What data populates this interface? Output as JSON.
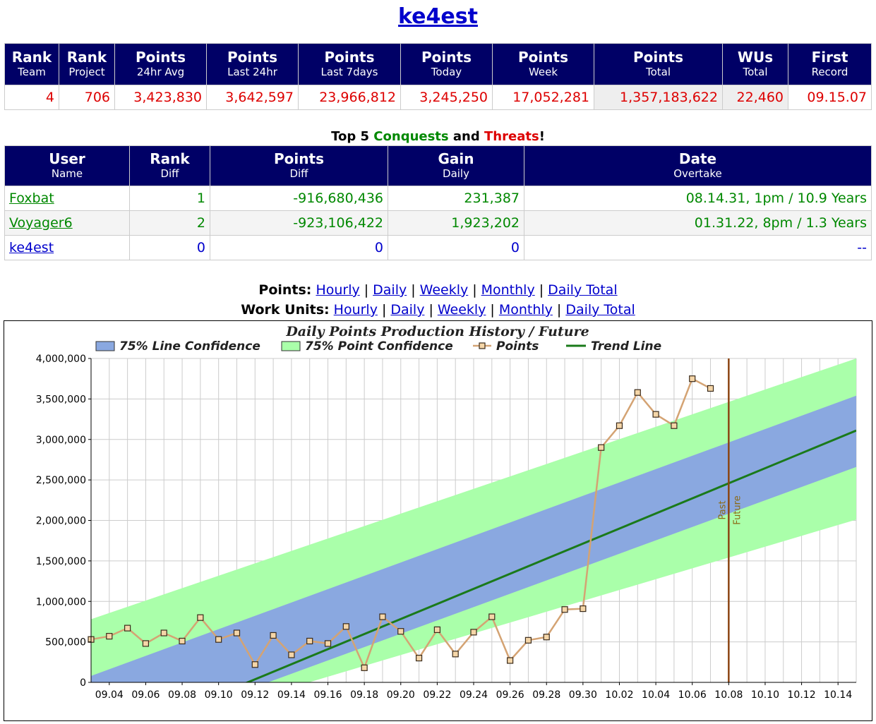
{
  "page_title": "ke4est",
  "stats": {
    "headers": [
      {
        "top": "Rank",
        "sub": "Team"
      },
      {
        "top": "Rank",
        "sub": "Project"
      },
      {
        "top": "Points",
        "sub": "24hr Avg"
      },
      {
        "top": "Points",
        "sub": "Last 24hr"
      },
      {
        "top": "Points",
        "sub": "Last 7days"
      },
      {
        "top": "Points",
        "sub": "Today"
      },
      {
        "top": "Points",
        "sub": "Week"
      },
      {
        "top": "Points",
        "sub": "Total"
      },
      {
        "top": "WUs",
        "sub": "Total"
      },
      {
        "top": "First",
        "sub": "Record"
      }
    ],
    "values": [
      "4",
      "706",
      "3,423,830",
      "3,642,597",
      "23,966,812",
      "3,245,250",
      "17,052,281",
      "1,357,183,622",
      "22,460",
      "09.15.07"
    ]
  },
  "rivals_caption": {
    "pre": "Top 5 ",
    "conquests": "Conquests",
    "mid": " and ",
    "threats": "Threats",
    "post": "!"
  },
  "rivals": {
    "headers": [
      {
        "top": "User",
        "sub": "Name"
      },
      {
        "top": "Rank",
        "sub": "Diff"
      },
      {
        "top": "Points",
        "sub": "Diff"
      },
      {
        "top": "Gain",
        "sub": "Daily"
      },
      {
        "top": "Date",
        "sub": "Overtake"
      }
    ],
    "rows": [
      {
        "name": "Foxbat",
        "rank_diff": "1",
        "points_diff": "-916,680,436",
        "gain": "231,387",
        "overtake": "08.14.31, 1pm / 10.9 Years"
      },
      {
        "name": "Voyager6",
        "rank_diff": "2",
        "points_diff": "-923,106,422",
        "gain": "1,923,202",
        "overtake": "01.31.22, 8pm / 1.3 Years"
      },
      {
        "name": "ke4est",
        "rank_diff": "0",
        "points_diff": "0",
        "gain": "0",
        "overtake": "--"
      }
    ]
  },
  "links": {
    "points_label": "Points:",
    "wu_label": "Work Units:",
    "items": [
      "Hourly",
      "Daily",
      "Weekly",
      "Monthly",
      "Daily Total"
    ],
    "separator": "|"
  },
  "colors": {
    "header_bg": "#000066",
    "red": "#dd0000",
    "green": "#008800",
    "link": "#0000cc"
  },
  "chart_data": {
    "type": "line",
    "title": "Daily Points Production History / Future",
    "legend": [
      "75% Line Confidence",
      "75% Point Confidence",
      "Points",
      "Trend Line"
    ],
    "legend_position": "top",
    "ylim": [
      0,
      4000000
    ],
    "yticks": [
      "0",
      "500,000",
      "1,000,000",
      "1,500,000",
      "2,000,000",
      "2,500,000",
      "3,000,000",
      "3,500,000",
      "4,000,000"
    ],
    "xticks": [
      "09.04",
      "09.06",
      "09.08",
      "09.10",
      "09.12",
      "09.14",
      "09.16",
      "09.18",
      "09.20",
      "09.22",
      "09.24",
      "09.26",
      "09.28",
      "09.30",
      "10.02",
      "10.04",
      "10.06",
      "10.08",
      "10.10",
      "10.12",
      "10.14"
    ],
    "x_dates": [
      "09.03",
      "09.04",
      "09.05",
      "09.06",
      "09.07",
      "09.08",
      "09.09",
      "09.10",
      "09.11",
      "09.12",
      "09.13",
      "09.14",
      "09.15",
      "09.16",
      "09.17",
      "09.18",
      "09.19",
      "09.20",
      "09.21",
      "09.22",
      "09.23",
      "09.24",
      "09.25",
      "09.26",
      "09.27",
      "09.28",
      "09.29",
      "09.30",
      "10.01",
      "10.02",
      "10.03",
      "10.04",
      "10.05",
      "10.06",
      "10.07"
    ],
    "points": [
      530000,
      570000,
      670000,
      480000,
      610000,
      510000,
      800000,
      530000,
      610000,
      220000,
      580000,
      340000,
      510000,
      480000,
      690000,
      180000,
      810000,
      630000,
      300000,
      650000,
      350000,
      620000,
      810000,
      270000,
      520000,
      560000,
      900000,
      910000,
      2900000,
      3170000,
      3580000,
      3310000,
      3170000,
      3750000,
      3630000
    ],
    "trend": {
      "start_date": "09.03",
      "start_value": -800000,
      "end_date": "10.15",
      "end_value": 3110000
    },
    "line_confidence": {
      "start_lower": -800000,
      "start_upper": 80000,
      "end_lower": 2660000,
      "end_upper": 3540000
    },
    "point_confidence": {
      "start_lower": -800000,
      "start_upper": 780000,
      "end_lower": 2010000,
      "end_upper": 4000000
    },
    "divider": {
      "date": "10.08",
      "labels": [
        "Past",
        "Future"
      ]
    },
    "colors": {
      "points": "#d4a373",
      "trend": "#1a7a1a",
      "line_band": "#8aa8e0",
      "point_band": "#aaffaa",
      "divider": "#8b4513"
    }
  }
}
